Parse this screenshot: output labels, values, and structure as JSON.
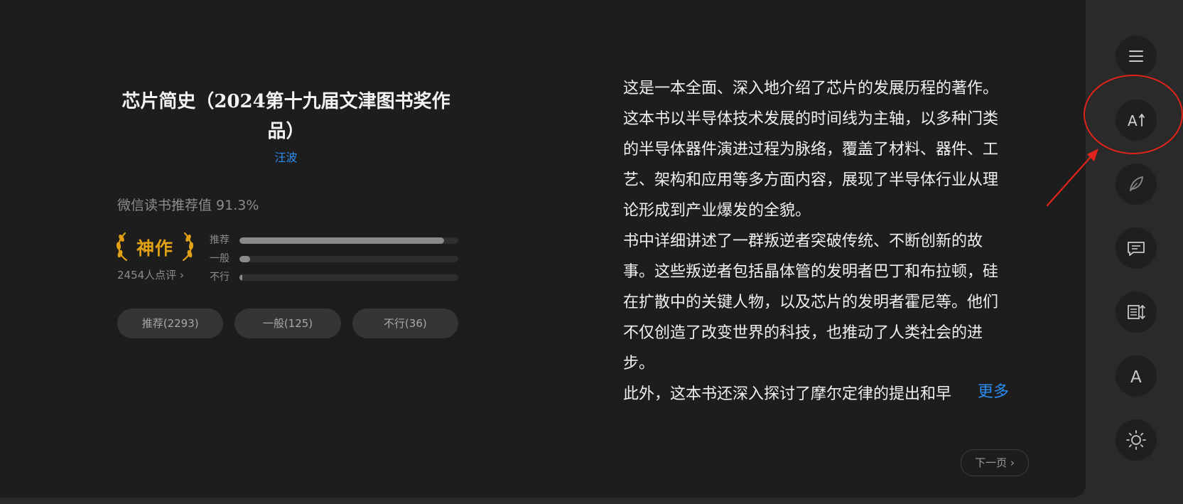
{
  "book": {
    "title": "芯片简史（2024第十九届文津图书奖作品）",
    "author": "汪波"
  },
  "rating": {
    "recommend_text": "微信读书推荐值 91.3%",
    "badge": "神作",
    "review_count": "2454人点评",
    "bars": [
      {
        "label": "推荐",
        "fraction": 0.935
      },
      {
        "label": "一般",
        "fraction": 0.05
      },
      {
        "label": "不行",
        "fraction": 0.012
      }
    ],
    "buttons": [
      {
        "label": "推荐(2293)"
      },
      {
        "label": "一般(125)"
      },
      {
        "label": "不行(36)"
      }
    ]
  },
  "intro": {
    "paragraphs": [
      "这是一本全面、深入地介绍了芯片的发展历程的著作。这本书以半导体技术发展的时间线为主轴，以多种门类的半导体器件演进过程为脉络，覆盖了材料、器件、工艺、架构和应用等多方面内容，展现了半导体行业从理论形成到产业爆发的全貌。",
      "书中详细讲述了一群叛逆者突破传统、不断创新的故事。这些叛逆者包括晶体管的发明者巴丁和布拉顿，硅在扩散中的关键人物，以及芯片的发明者霍尼等。他们不仅创造了改变世界的科技，也推动了人类社会的进步。",
      "此外，这本书还深入探讨了摩尔定律的提出和早"
    ],
    "more_label": "更多"
  },
  "next_page_label": "下一页",
  "sidebar_icons": [
    "menu-icon",
    "font-size-icon",
    "pen-icon",
    "comment-icon",
    "toc-sort-icon",
    "font-icon",
    "brightness-icon"
  ],
  "colors": {
    "accent_blue": "#2b8cf0",
    "badge_gold": "#e0a117",
    "annotation_red": "#e0241b"
  }
}
